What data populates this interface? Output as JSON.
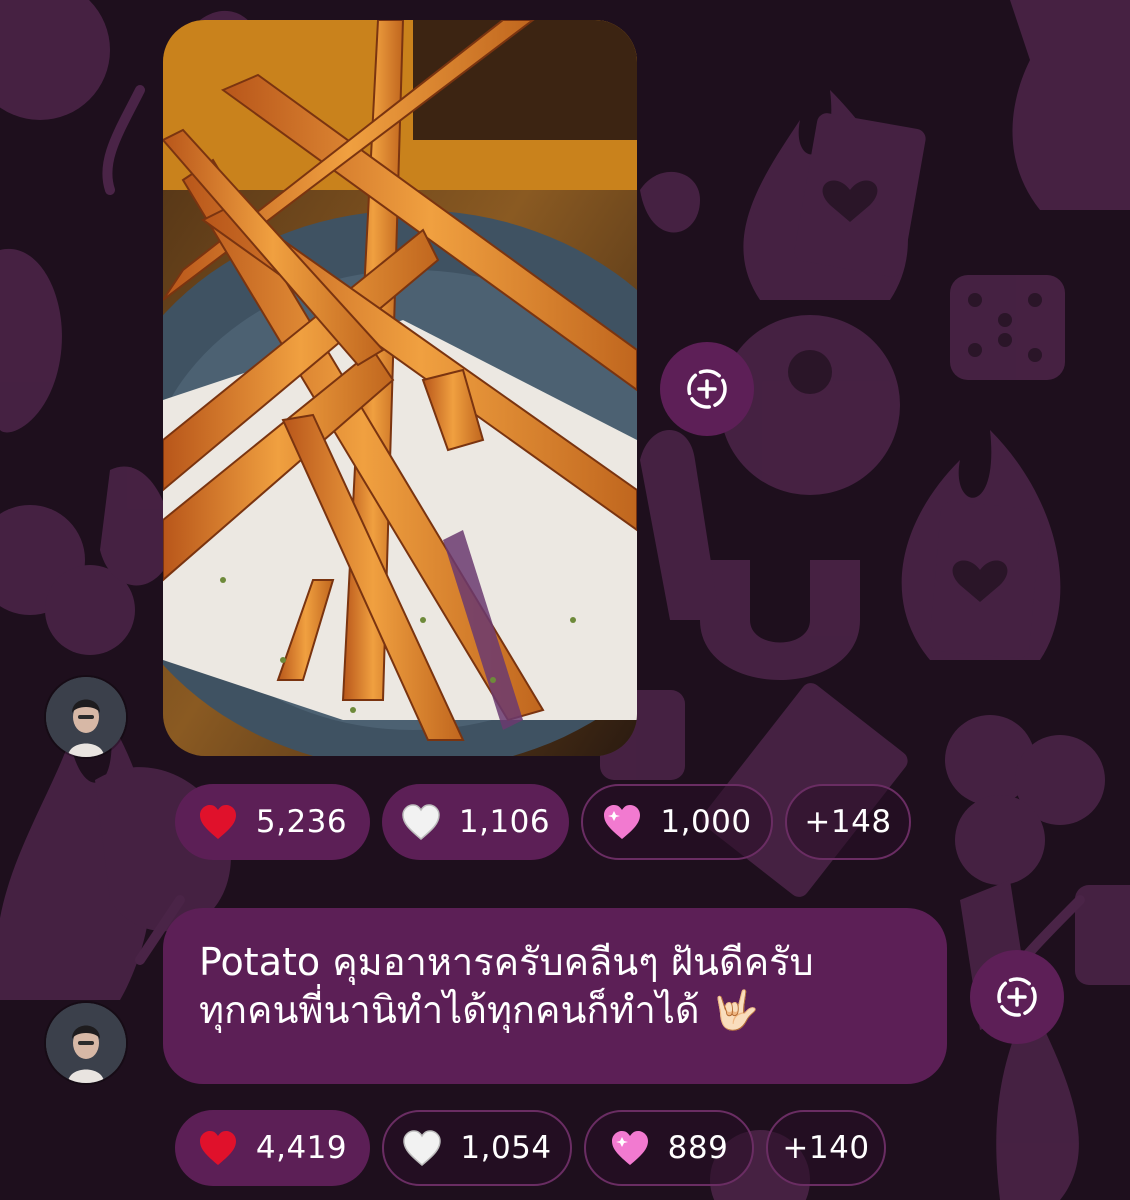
{
  "messages": [
    {
      "type": "photo",
      "photo_alt": "Plate of sweet potato fries",
      "reactions": [
        {
          "icon": "red-heart-icon",
          "count": "5,236"
        },
        {
          "icon": "white-heart-icon",
          "count": "1,106"
        },
        {
          "icon": "sparkling-heart-icon",
          "count": "1,000"
        },
        {
          "icon": "",
          "count": "+148"
        }
      ]
    },
    {
      "type": "text",
      "text_line1": "Potato คุมอาหารครับคลีนๆ ฝันดีครับ",
      "text_line2": "ทุกคนพี่นานิทำได้ทุกคนก็ทำได้",
      "text_emoji": "🤟🏻",
      "reactions": [
        {
          "icon": "red-heart-icon",
          "count": "4,419"
        },
        {
          "icon": "white-heart-icon",
          "count": "1,054"
        },
        {
          "icon": "sparkling-heart-icon",
          "count": "889"
        },
        {
          "icon": "",
          "count": "+140"
        }
      ]
    }
  ],
  "colors": {
    "background": "#1e0f1d",
    "pattern": "#4a2447",
    "bubble": "#5c1f56",
    "pill_outline": "#6a2d63"
  }
}
